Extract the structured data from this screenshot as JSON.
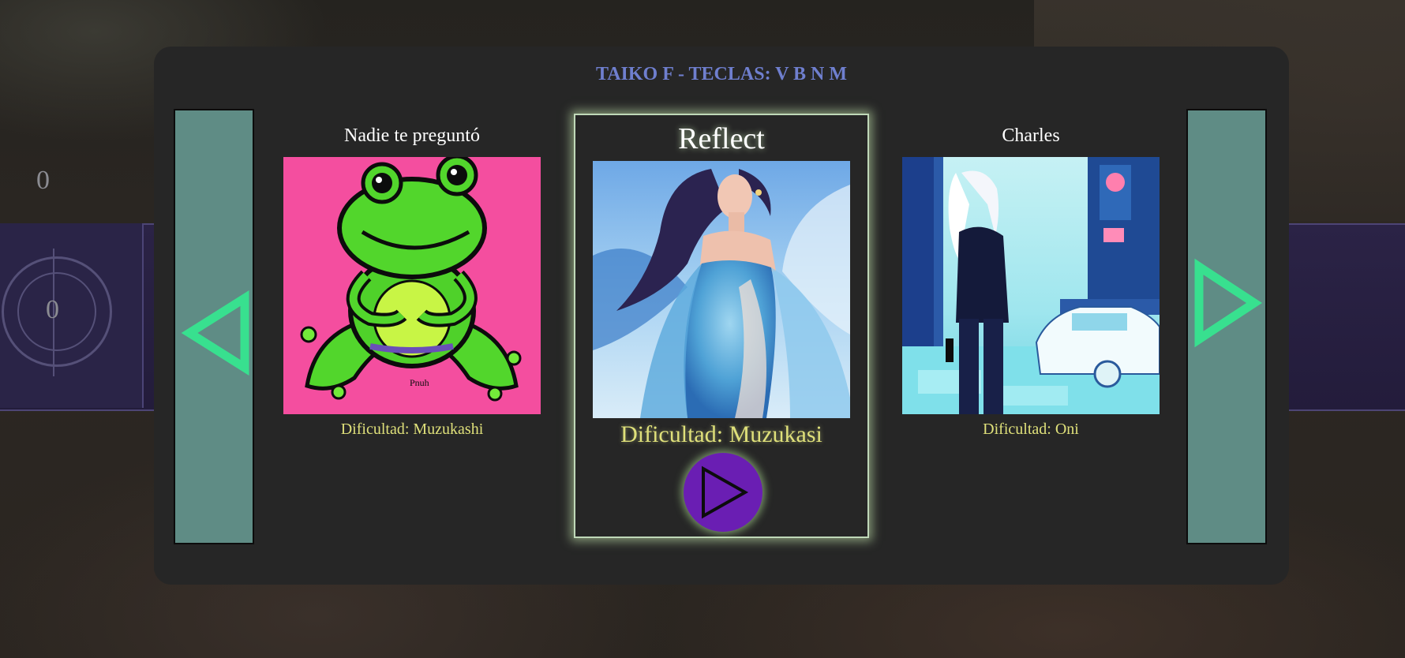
{
  "background": {
    "score": "0",
    "combo": "0"
  },
  "selector": {
    "title": "TAIKO F - TECLAS: V B N M",
    "prev_icon": "triangle-left-icon",
    "next_icon": "triangle-right-icon",
    "play_icon": "play-icon",
    "arrow_color": "#38e08f",
    "arrow_button_bg": "#5f8c85",
    "panel_bg": "#262626",
    "play_button_bg": "#6a1eb3",
    "difficulty_color": "#dfe07a",
    "title_color": "#6f7fcf",
    "songs": [
      {
        "title": "Nadie te preguntó",
        "difficulty": "Dificultad: Muzukashi",
        "art": "green-frog-on-pink-art"
      },
      {
        "title": "Reflect",
        "difficulty": "Dificultad: Muzukasi",
        "art": "blue-feather-dress-woman-art"
      },
      {
        "title": "Charles",
        "difficulty": "Dificultad: Oni",
        "art": "cyan-city-girl-and-car-art"
      }
    ]
  }
}
